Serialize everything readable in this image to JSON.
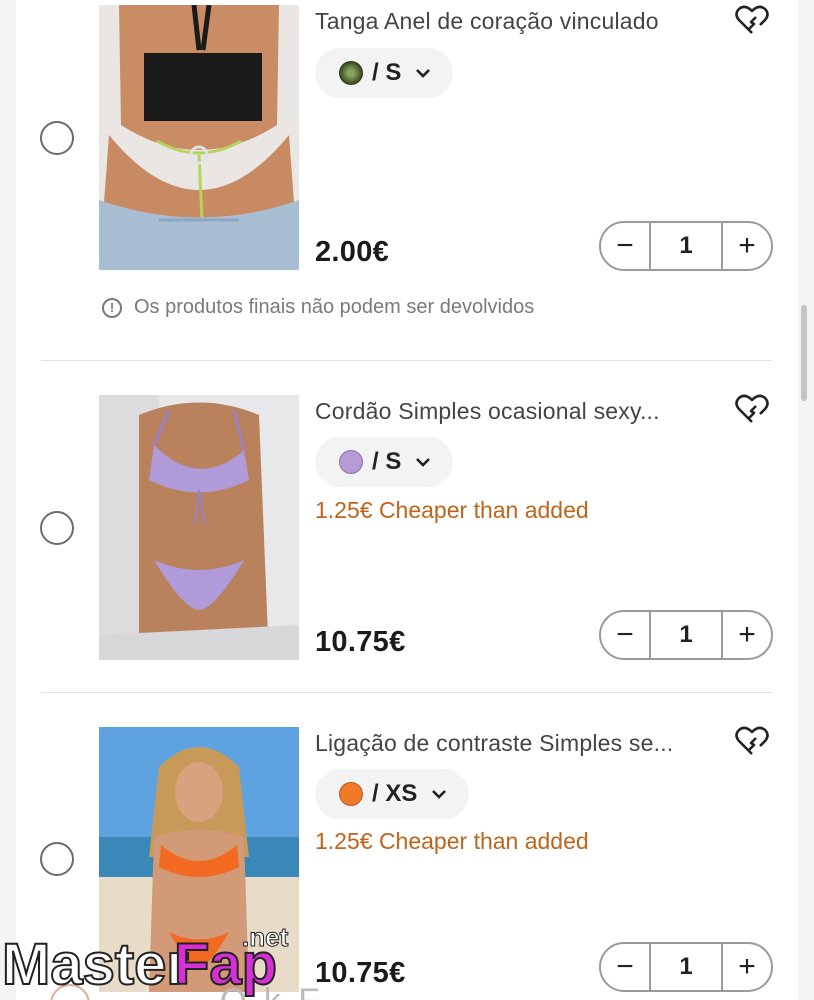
{
  "items": [
    {
      "title": "Tanga Anel de coração vinculado",
      "variant": {
        "color": "#5a7a3a",
        "size": "/ S"
      },
      "cheaper_note": "",
      "price": "2.00€",
      "quantity": "1",
      "notice": "Os produtos finais não podem ser devolvidos"
    },
    {
      "title": "Cordão Simples ocasional sexy...",
      "variant": {
        "color": "#b79ad6",
        "size": "/ S"
      },
      "cheaper_note": "1.25€ Cheaper than added",
      "price": "10.75€",
      "quantity": "1"
    },
    {
      "title": "Ligação de contraste Simples se...",
      "variant": {
        "color": "#f07a2a",
        "size": "/ XS"
      },
      "cheaper_note": "1.25€ Cheaper than added",
      "price": "10.75€",
      "quantity": "1"
    }
  ],
  "stepper": {
    "minus": "−",
    "plus": "+"
  },
  "icons": {
    "radio": "radio-unchecked-icon",
    "wishlist": "heart-add-icon",
    "dropdown": "chevron-down-icon",
    "info": "info-icon"
  },
  "colors": {
    "accent_orange": "#c0631b",
    "text": "#222222",
    "muted": "#7a7a7a"
  },
  "watermark": {
    "text": "MasterFap",
    "suffix": ".net"
  },
  "footer_peek": "O  k  F"
}
